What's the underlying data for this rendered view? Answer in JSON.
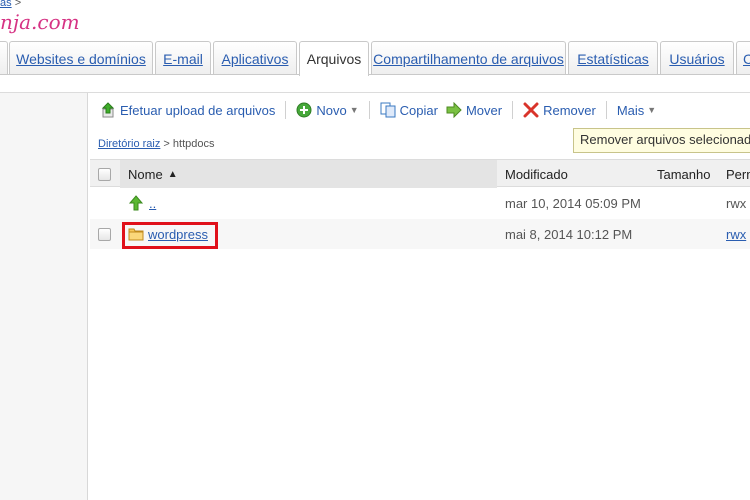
{
  "header": {
    "crumb": "as",
    "crumb_sep": ">",
    "domain": "nja.com"
  },
  "tabs": [
    {
      "label": "",
      "left": 0
    },
    {
      "label": "Websites e domínios"
    },
    {
      "label": "E-mail"
    },
    {
      "label": "Aplicativos"
    },
    {
      "label": "Arquivos",
      "active": true
    },
    {
      "label": "Compartilhamento de arquivos"
    },
    {
      "label": "Estatísticas"
    },
    {
      "label": "Usuários"
    },
    {
      "label": "C"
    }
  ],
  "toolbar": {
    "upload": "Efetuar upload de arquivos",
    "new": "Novo",
    "copy": "Copiar",
    "move": "Mover",
    "remove": "Remover",
    "more": "Mais"
  },
  "path": {
    "root": "Diretório raiz",
    "sep": ">",
    "current": "httpdocs"
  },
  "tooltip": "Remover arquivos selecionados",
  "table": {
    "headers": {
      "name": "Nome",
      "modified": "Modificado",
      "size": "Tamanho",
      "perm": "Perm"
    },
    "rows": [
      {
        "name": "..",
        "modified": "mar 10, 2014 05:09 PM",
        "perm": "rwx"
      },
      {
        "name": "wordpress",
        "modified": "mai 8, 2014 10:12 PM",
        "perm": "rwx"
      }
    ]
  },
  "colors": {
    "link": "#2a5db0",
    "domain": "#d63384",
    "highlight": "#e0101a"
  }
}
